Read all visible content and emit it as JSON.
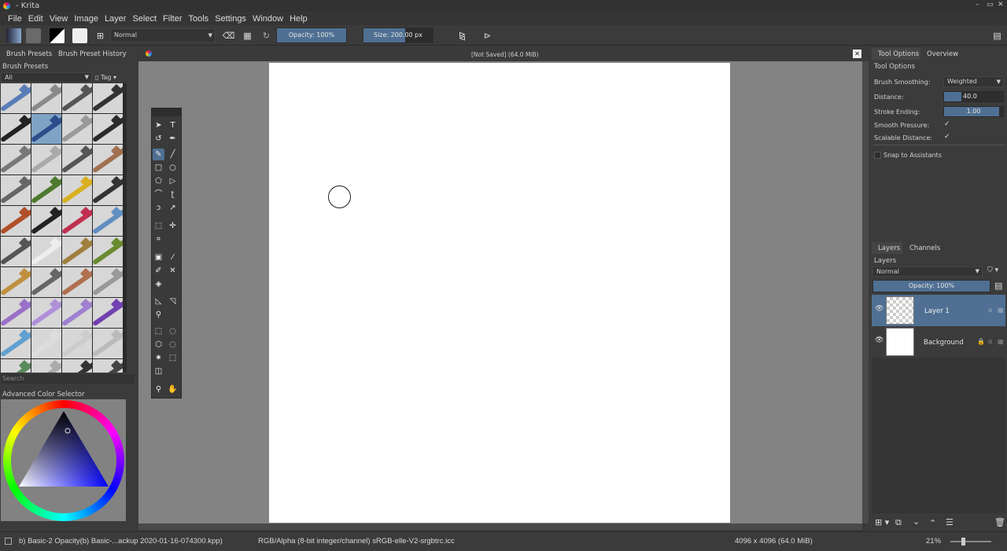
{
  "window": {
    "title": "- Krita",
    "min": "–",
    "max": "▭",
    "close": "✕"
  },
  "menu": [
    "File",
    "Edit",
    "View",
    "Image",
    "Layer",
    "Select",
    "Filter",
    "Tools",
    "Settings",
    "Window",
    "Help"
  ],
  "toolbar": {
    "blend_mode": "Normal",
    "opacity_label": "Opacity: 100%",
    "opacity_value": 100,
    "size_label": "Size: 200.00 px",
    "size_fill_fraction": 0.6
  },
  "left_panel": {
    "tabs": [
      "Brush Presets",
      "Brush Preset History"
    ],
    "title": "Brush Presets",
    "filter": "All",
    "tag_label": "Tag",
    "search_placeholder": "Search",
    "color_selector_title": "Advanced Color Selector"
  },
  "brushes": [
    {
      "c": "#5a7db8"
    },
    {
      "c": "#8a8a8a"
    },
    {
      "c": "#555"
    },
    {
      "c": "#333"
    },
    {
      "c": "#222"
    },
    {
      "c": "#2b4d8a",
      "sel": true
    },
    {
      "c": "#999"
    },
    {
      "c": "#2a2a2a"
    },
    {
      "c": "#777"
    },
    {
      "c": "#aaa"
    },
    {
      "c": "#555"
    },
    {
      "c": "#a07050"
    },
    {
      "c": "#666"
    },
    {
      "c": "#4d7a2e"
    },
    {
      "c": "#d9b020"
    },
    {
      "c": "#333"
    },
    {
      "c": "#b0502a"
    },
    {
      "c": "#222"
    },
    {
      "c": "#c03050"
    },
    {
      "c": "#6090c0"
    },
    {
      "c": "#555"
    },
    {
      "c": "#eee"
    },
    {
      "c": "#a07f40"
    },
    {
      "c": "#6a8a30"
    },
    {
      "c": "#c09040"
    },
    {
      "c": "#666"
    },
    {
      "c": "#b07050"
    },
    {
      "c": "#999"
    },
    {
      "c": "#9a70c8"
    },
    {
      "c": "#b090d8"
    },
    {
      "c": "#a080d0"
    },
    {
      "c": "#7040b0"
    },
    {
      "c": "#60a0d0"
    },
    {
      "c": "#ddd"
    },
    {
      "c": "#ccc"
    },
    {
      "c": "#bbb"
    },
    {
      "c": "#5a8a5a"
    },
    {
      "c": "#aaa"
    },
    {
      "c": "#333"
    },
    {
      "c": "#444"
    }
  ],
  "document": {
    "tab_title": "[Not Saved]  (64.0 MiB)"
  },
  "tool_options": {
    "tabs": [
      "Tool Options",
      "Overview"
    ],
    "title": "Tool Options",
    "brush_smoothing_label": "Brush Smoothing:",
    "brush_smoothing_value": "Weighted",
    "distance_label": "Distance:",
    "distance_value": "40.0",
    "stroke_ending_label": "Stroke Ending:",
    "stroke_ending_value": "1.00",
    "smooth_pressure_label": "Smooth Pressure:",
    "scalable_distance_label": "Scalable Distance:",
    "snap_label": "Snap to Assistants",
    "check_mark": "✓"
  },
  "layers": {
    "tabs": [
      "Layers",
      "Channels"
    ],
    "title": "Layers",
    "blend_mode": "Normal",
    "opacity_label": "Opacity:  100%",
    "items": [
      {
        "name": "Layer 1",
        "selected": true,
        "transparent": true
      },
      {
        "name": "Background",
        "selected": false,
        "transparent": false,
        "locked": true
      }
    ]
  },
  "status": {
    "brush": "b) Basic-2 Opacity(b) Basic-...ackup 2020-01-16-074300.kpp)",
    "color_model": "RGB/Alpha (8-bit integer/channel)  sRGB-elle-V2-srgbtrc.icc",
    "image_size": "4096 x 4096 (64.0 MiB)",
    "zoom": "21%"
  },
  "colors": {
    "accent": "#4f7093",
    "canvas_bg": "#838383",
    "panel": "#3b3b3b"
  }
}
